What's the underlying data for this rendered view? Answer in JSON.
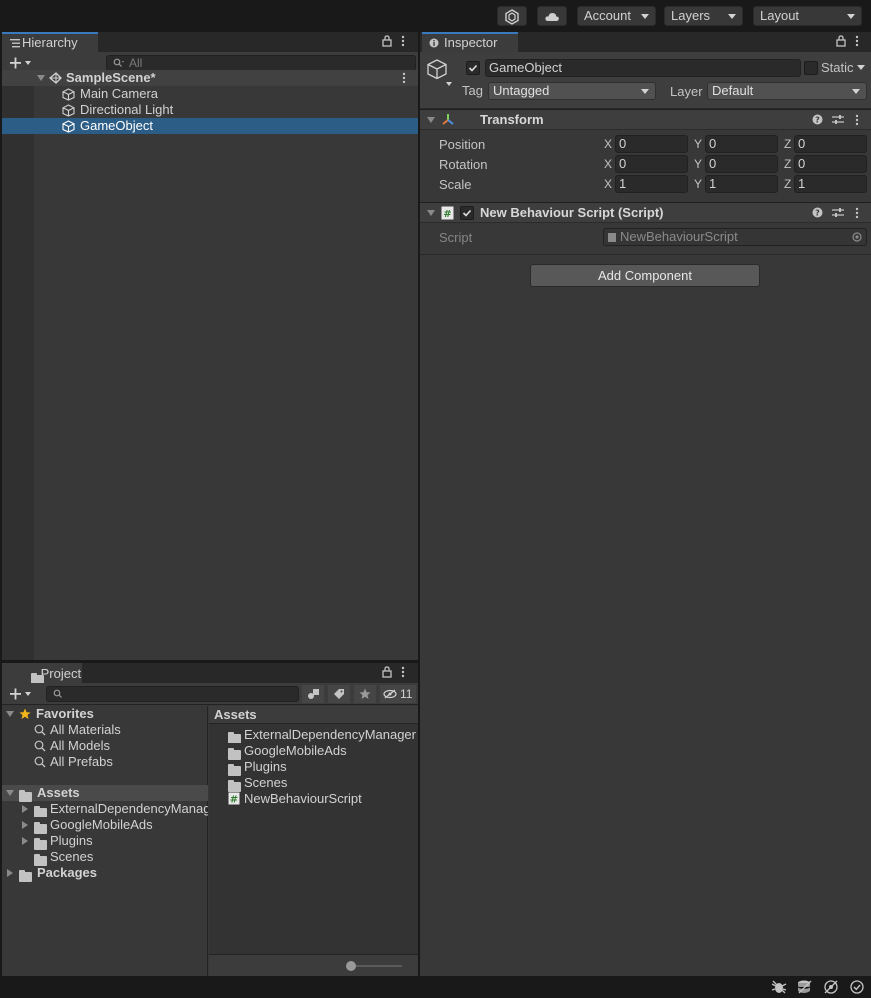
{
  "toolbar": {
    "account_label": "Account",
    "layers_label": "Layers",
    "layout_label": "Layout",
    "icons": [
      "collab-icon",
      "cloud-icon"
    ]
  },
  "hierarchy": {
    "tab_label": "Hierarchy",
    "search_placeholder": "All",
    "scene_name": "SampleScene*",
    "items": [
      {
        "label": "Main Camera",
        "selected": false
      },
      {
        "label": "Directional Light",
        "selected": false
      },
      {
        "label": "GameObject",
        "selected": true
      }
    ]
  },
  "inspector": {
    "tab_label": "Inspector",
    "object_name": "GameObject",
    "static_label": "Static",
    "tag_label": "Tag",
    "tag_value": "Untagged",
    "layer_label": "Layer",
    "layer_value": "Default",
    "transform": {
      "title": "Transform",
      "rows": [
        {
          "label": "Position",
          "x": "0",
          "y": "0",
          "z": "0"
        },
        {
          "label": "Rotation",
          "x": "0",
          "y": "0",
          "z": "0"
        },
        {
          "label": "Scale",
          "x": "1",
          "y": "1",
          "z": "1"
        }
      ],
      "axis_x": "X",
      "axis_y": "Y",
      "axis_z": "Z"
    },
    "script_component": {
      "title": "New Behaviour Script (Script)",
      "script_label": "Script",
      "script_value": "NewBehaviourScript"
    },
    "add_component_label": "Add Component"
  },
  "project": {
    "tab_label": "Project",
    "hidden_count": "11",
    "favorites_label": "Favorites",
    "favorites": [
      "All Materials",
      "All Models",
      "All Prefabs"
    ],
    "assets_label": "Assets",
    "asset_folders": [
      "ExternalDependencyManager",
      "GoogleMobileAds",
      "Plugins",
      "Scenes"
    ],
    "packages_label": "Packages",
    "right_header": "Assets",
    "right_items": [
      {
        "label": "ExternalDependencyManager",
        "kind": "folder"
      },
      {
        "label": "GoogleMobileAds",
        "kind": "folder"
      },
      {
        "label": "Plugins",
        "kind": "folder"
      },
      {
        "label": "Scenes",
        "kind": "folder"
      },
      {
        "label": "NewBehaviourScript",
        "kind": "script"
      }
    ]
  },
  "colors": {
    "accent": "#3a79bb",
    "selection": "#2c5d87",
    "panel": "#383838"
  }
}
